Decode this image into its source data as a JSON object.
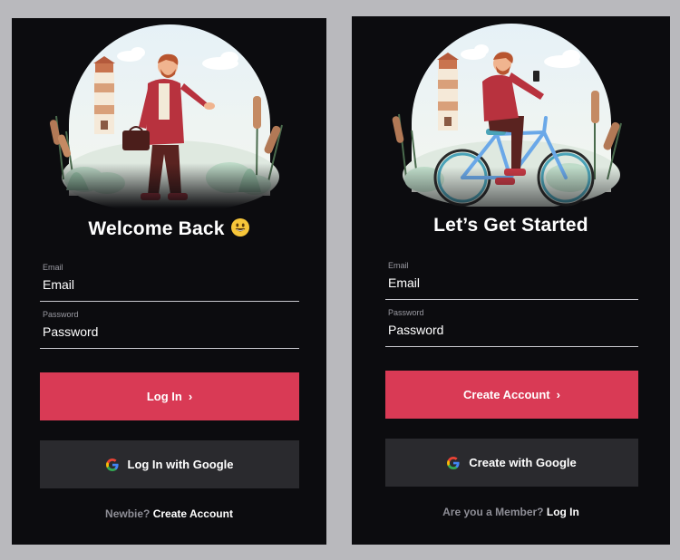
{
  "login": {
    "title": "Welcome Back",
    "email": {
      "label": "Email",
      "placeholder": "Email"
    },
    "password": {
      "label": "Password",
      "placeholder": "Password"
    },
    "primary_label": "Log In",
    "google_label": "Log In with Google",
    "footer_prompt": "Newbie?",
    "footer_link": "Create Account"
  },
  "signup": {
    "title": "Let’s Get Started",
    "email": {
      "label": "Email",
      "placeholder": "Email"
    },
    "password": {
      "label": "Password",
      "placeholder": "Password"
    },
    "primary_label": "Create Account",
    "google_label": "Create with Google",
    "footer_prompt": "Are you a Member?",
    "footer_link": "Log In"
  },
  "colors": {
    "accent": "#d93a55",
    "card_bg": "#0c0c0f",
    "secondary_button": "#2a2a2e",
    "page_bg": "#b9b9bd"
  },
  "icons": {
    "primary_chevron": "chevron-right-icon",
    "google": "google-icon",
    "title_emoji": "smiley-emoji-icon"
  }
}
